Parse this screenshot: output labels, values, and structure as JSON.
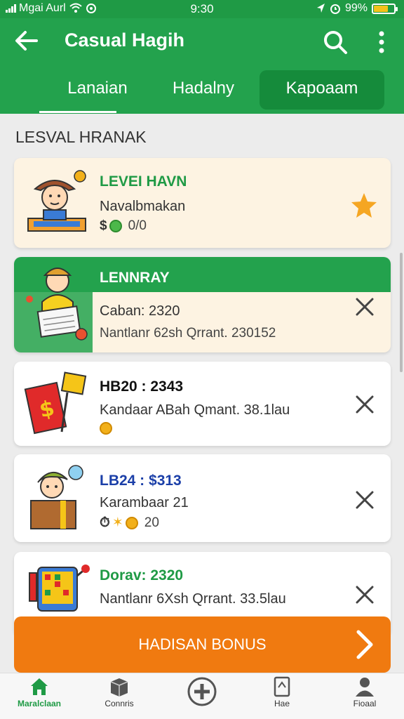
{
  "status_bar": {
    "carrier": "Mgai Aurl",
    "time": "9:30",
    "battery_text": "99%",
    "battery_level": 0.7
  },
  "app_bar": {
    "title": "Casual Hagih",
    "back_icon": "arrow-left-icon",
    "search_icon": "search-icon",
    "more_icon": "more-vert-icon"
  },
  "tabs": [
    {
      "label": "Lanaian",
      "active": true
    },
    {
      "label": "Hadalny",
      "active": false
    },
    {
      "label": "Kapoaam",
      "active": false
    }
  ],
  "section_heading": "LESVAL HRANAK",
  "cards": [
    {
      "title": "LEVEI HAVN",
      "line2": "Navalbmakan",
      "line3": "0/0",
      "trailing_icon": "star-icon"
    },
    {
      "title": "LENNRAY",
      "line2": "Caban: 2320",
      "line3": "Nantlanr 62sh Qrrant. 230152",
      "trailing_icon": "close-icon"
    },
    {
      "title": "HB20 : 2343",
      "line2": "Kandaar ABah Qmant. 38.1lau",
      "trailing_icon": "close-icon"
    },
    {
      "title": "LB24 : $313",
      "line2": "Karambaar 21",
      "line3": "20",
      "trailing_icon": "close-icon"
    },
    {
      "title": "Dorav: 2320",
      "line2": "Nantlanr 6Xsh Qrrant. 33.5lau",
      "trailing_icon": "close-icon"
    }
  ],
  "bonus_button": {
    "label": "HADISAN BONUS"
  },
  "bottom_nav": [
    {
      "label": "Maralclaan",
      "icon": "home-icon",
      "active": true
    },
    {
      "label": "Connris",
      "icon": "box-icon",
      "active": false
    },
    {
      "label": "",
      "icon": "plus-circle-icon",
      "active": false
    },
    {
      "label": "Hae",
      "icon": "tablet-icon",
      "active": false
    },
    {
      "label": "Fioaal",
      "icon": "person-icon",
      "active": false
    }
  ],
  "colors": {
    "primary_green": "#23a24d",
    "dark_green": "#158b3b",
    "orange": "#f07a10",
    "card_cream": "#fdf3e2",
    "title_green": "#1f9a45",
    "title_blue": "#1b3fa8"
  }
}
